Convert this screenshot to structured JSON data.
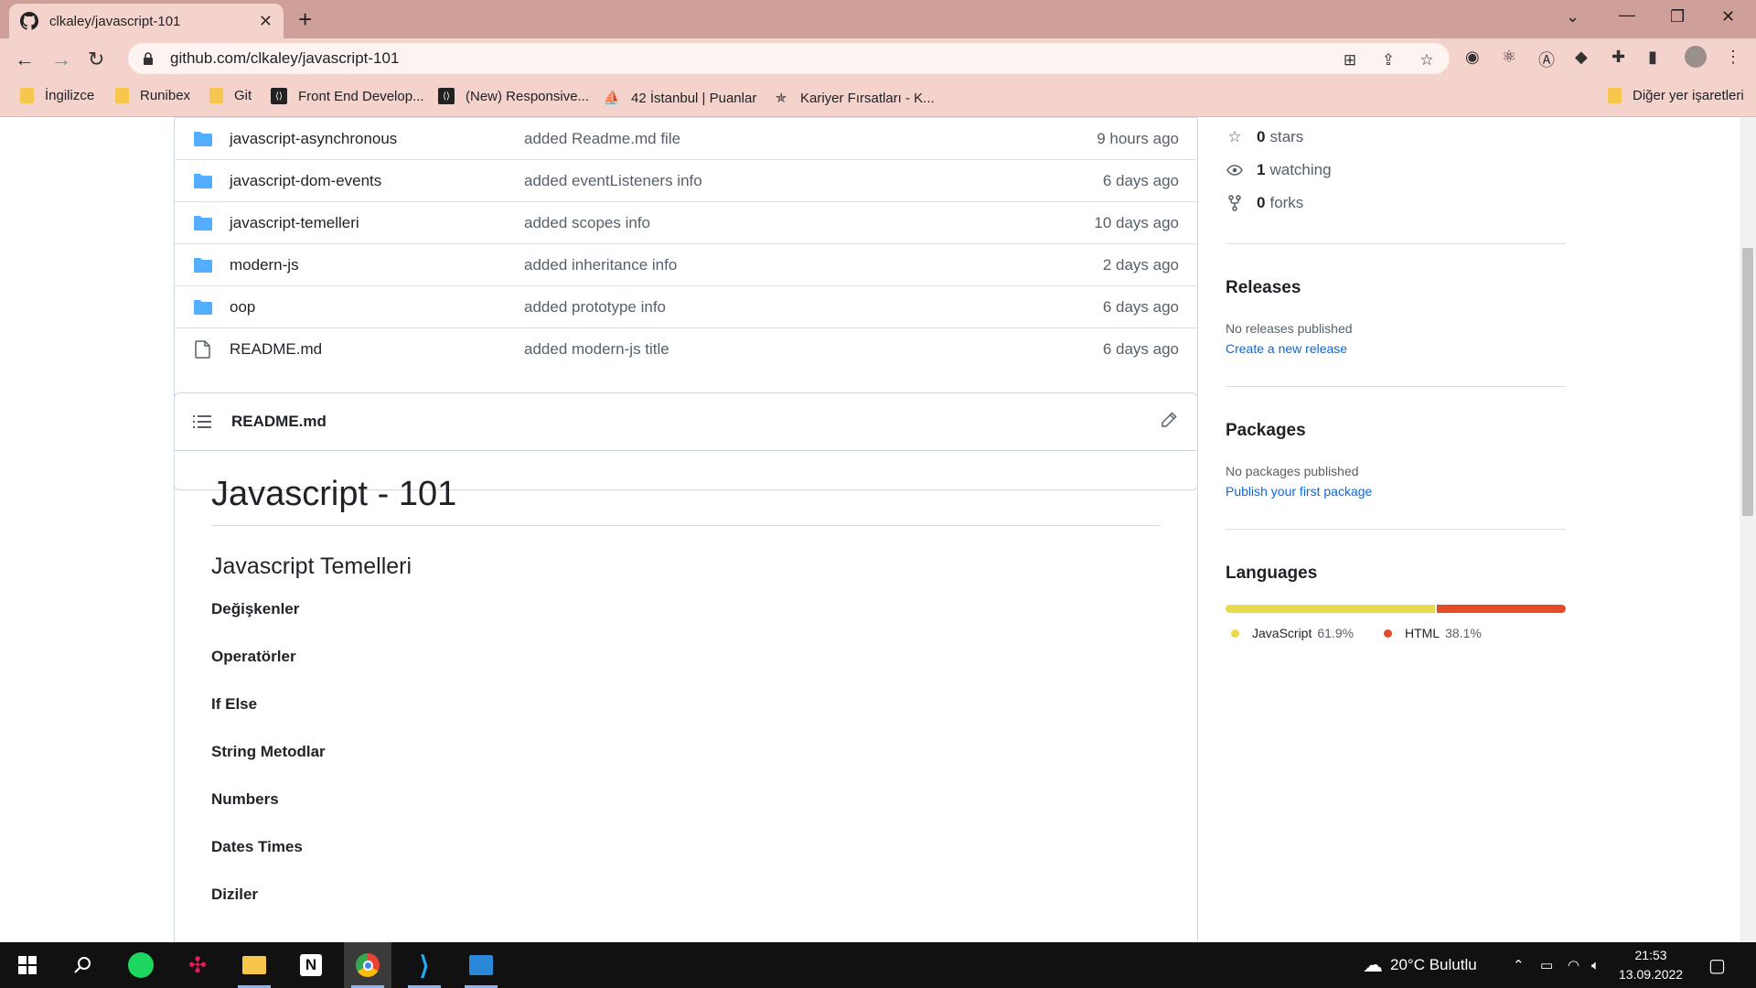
{
  "browser": {
    "tab_title": "clkaley/javascript-101",
    "url": "github.com/clkaley/javascript-101",
    "bookmarks": [
      {
        "label": "İngilizce",
        "icon": "folder-icon"
      },
      {
        "label": "Runibex",
        "icon": "folder-icon"
      },
      {
        "label": "Git",
        "icon": "folder-icon"
      },
      {
        "label": "Front End Develop...",
        "icon": "dev-icon"
      },
      {
        "label": "(New) Responsive...",
        "icon": "dev-icon"
      },
      {
        "label": "42 İstanbul | Puanlar",
        "icon": "site-icon"
      },
      {
        "label": "Kariyer Fırsatları - K...",
        "icon": "site-icon"
      }
    ],
    "other_bookmarks": "Diğer yer işaretleri"
  },
  "files": [
    {
      "name": "javascript-asynchronous",
      "message": "added Readme.md file",
      "time": "9 hours ago",
      "type": "folder"
    },
    {
      "name": "javascript-dom-events",
      "message": "added eventListeners info",
      "time": "6 days ago",
      "type": "folder"
    },
    {
      "name": "javascript-temelleri",
      "message": "added scopes info",
      "time": "10 days ago",
      "type": "folder"
    },
    {
      "name": "modern-js",
      "message": "added inheritance info",
      "time": "2 days ago",
      "type": "folder"
    },
    {
      "name": "oop",
      "message": "added prototype info",
      "time": "6 days ago",
      "type": "folder"
    },
    {
      "name": "README.md",
      "message": "added modern-js title",
      "time": "6 days ago",
      "type": "file"
    }
  ],
  "readme": {
    "filename": "README.md",
    "h1": "Javascript - 101",
    "h2": "Javascript Temelleri",
    "items": [
      "Değişkenler",
      "Operatörler",
      "If Else",
      "String Metodlar",
      "Numbers",
      "Dates Times",
      "Diziler"
    ]
  },
  "sidebar": {
    "stars": {
      "count": "0",
      "label": "stars"
    },
    "watching": {
      "count": "1",
      "label": "watching"
    },
    "forks": {
      "count": "0",
      "label": "forks"
    },
    "releases": {
      "title": "Releases",
      "text": "No releases published",
      "link": "Create a new release"
    },
    "packages": {
      "title": "Packages",
      "text": "No packages published",
      "link": "Publish your first package"
    },
    "languages": {
      "title": "Languages",
      "items": [
        {
          "name": "JavaScript",
          "percent": "61.9%",
          "value": 61.9,
          "color": "#f1e05a"
        },
        {
          "name": "HTML",
          "percent": "38.1%",
          "value": 38.1,
          "color": "#e34c26"
        }
      ]
    }
  },
  "taskbar": {
    "weather": "20°C Bulutlu",
    "time": "21:53",
    "date": "13.09.2022"
  }
}
